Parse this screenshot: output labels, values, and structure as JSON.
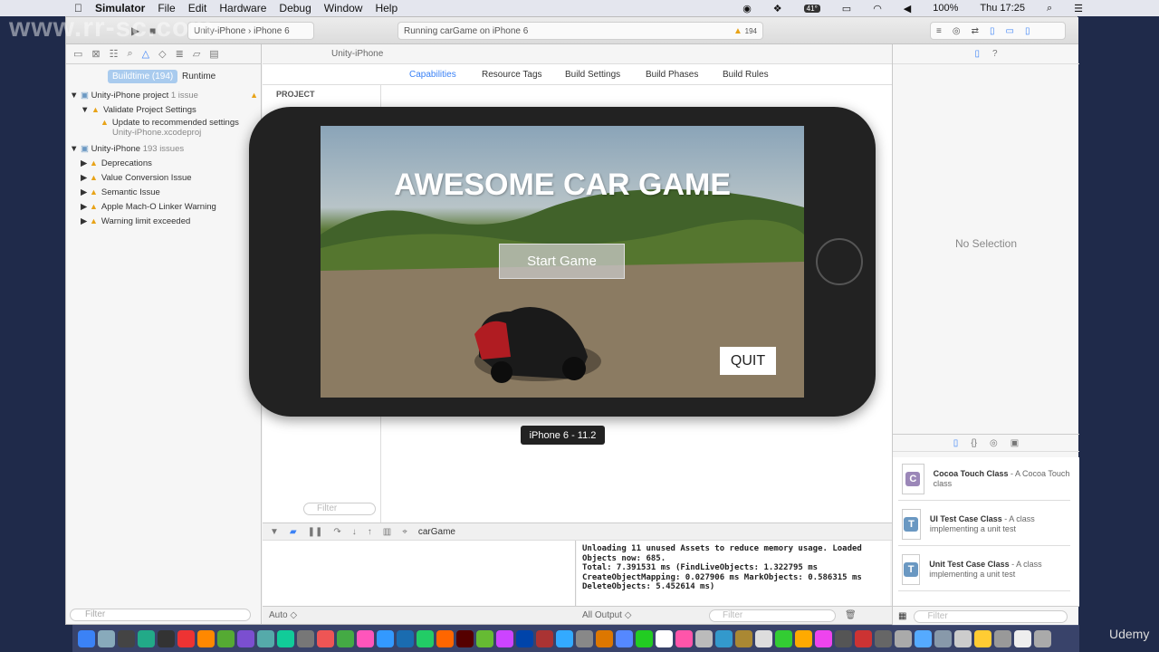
{
  "menubar": {
    "apple": "",
    "app": "Simulator",
    "items": [
      "File",
      "Edit",
      "Hardware",
      "Debug",
      "Window",
      "Help"
    ],
    "temp": "41°",
    "battery": "100%",
    "clock": "Thu 17:25"
  },
  "toolbar": {
    "scheme": "Unity-iPhone",
    "device": "iPhone 6",
    "activity": "Running carGame on iPhone 6",
    "warning_count": "194"
  },
  "navigator": {
    "tabs": [
      "Buildtime (194)",
      "Runtime"
    ],
    "items": [
      {
        "label": "Unity-iPhone project",
        "detail": "1 issue"
      },
      {
        "label": "Validate Project Settings"
      },
      {
        "label": "Update to recommended settings",
        "detail": "Unity-iPhone.xcodeproj"
      },
      {
        "label": "Unity-iPhone",
        "detail": "193 issues"
      },
      {
        "label": "Deprecations"
      },
      {
        "label": "Value Conversion Issue"
      },
      {
        "label": "Semantic Issue"
      },
      {
        "label": "Apple Mach-O Linker Warning"
      },
      {
        "label": "Warning limit exceeded"
      }
    ],
    "filter_placeholder": "Filter"
  },
  "editor": {
    "breadcrumb": "Unity-iPhone",
    "tabs": [
      "Capabilities",
      "Resource Tags",
      "Build Settings",
      "Build Phases",
      "Build Rules"
    ],
    "section": "PROJECT",
    "filter_placeholder": "Filter"
  },
  "debug": {
    "target": "carGame",
    "auto": "Auto ◇",
    "output": "All Output ◇",
    "filter_placeholder": "Filter",
    "console": "Unloading 11 unused Assets to reduce memory usage. Loaded\nObjects now: 685.\nTotal: 7.391531 ms (FindLiveObjects: 1.322795 ms\nCreateObjectMapping: 0.027906 ms MarkObjects: 0.586315 ms\nDeleteObjects: 5.452614 ms)"
  },
  "inspector": {
    "empty": "No Selection",
    "templates": [
      {
        "name": "Cocoa Touch Class",
        "desc": " - A Cocoa Touch class",
        "letter": "C",
        "color": "#9b87b8"
      },
      {
        "name": "UI Test Case Class",
        "desc": " - A class implementing a unit test",
        "letter": "T",
        "color": "#6a98c2"
      },
      {
        "name": "Unit Test Case Class",
        "desc": " - A class implementing a unit test",
        "letter": "T",
        "color": "#6a98c2"
      }
    ],
    "filter_placeholder": "Filter"
  },
  "game": {
    "title": "AWESOME CAR GAME",
    "start": "Start Game",
    "quit": "QUIT"
  },
  "simulator": {
    "label": "iPhone 6 - 11.2"
  },
  "watermark": {
    "site": "www.rr-sc.com",
    "brand": "Udemy"
  }
}
